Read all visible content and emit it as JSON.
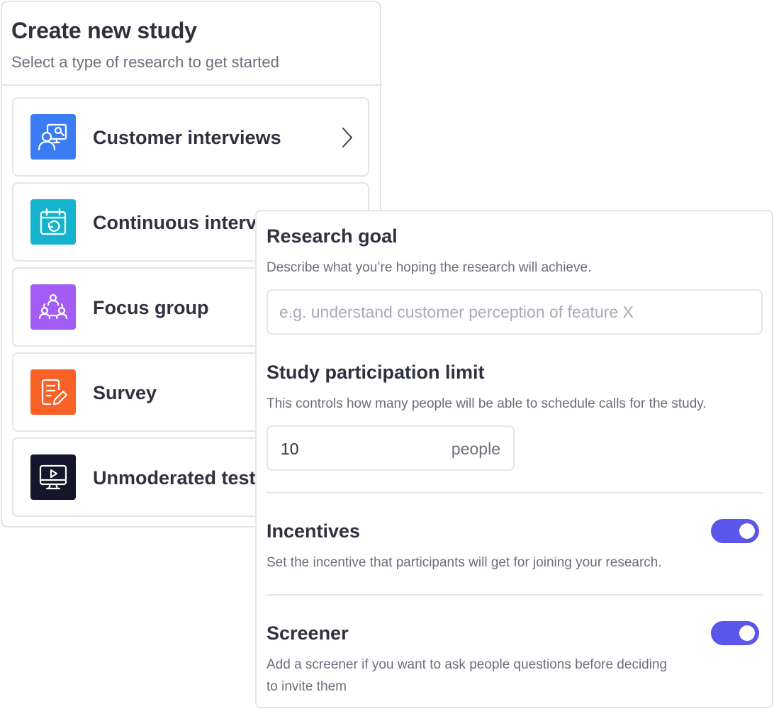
{
  "study_card": {
    "title": "Create new study",
    "subtitle": "Select a type of research to get started",
    "types": [
      {
        "label": "Customer interviews",
        "icon": "presentation-user-icon",
        "color": "#3b7cf5"
      },
      {
        "label": "Continuous interviews",
        "icon": "calendar-refresh-icon",
        "color": "#16b3cf"
      },
      {
        "label": "Focus group",
        "icon": "group-users-icon",
        "color": "#a35cf4"
      },
      {
        "label": "Survey",
        "icon": "document-edit-icon",
        "color": "#fa6127"
      },
      {
        "label": "Unmoderated testing",
        "icon": "monitor-play-icon",
        "color": "#15152b"
      }
    ]
  },
  "config_panel": {
    "research_goal": {
      "title": "Research goal",
      "description": "Describe what you’re hoping the research will achieve.",
      "placeholder": "e.g. understand customer perception of feature X",
      "value": ""
    },
    "participation_limit": {
      "title": "Study participation limit",
      "description": "This controls how many people will be able to schedule calls for the study.",
      "value": "10",
      "unit": "people"
    },
    "incentives": {
      "title": "Incentives",
      "description": "Set the incentive that participants will get for joining your research.",
      "enabled": true
    },
    "screener": {
      "title": "Screener",
      "description_line1": "Add a screener if you want to ask people questions before deciding",
      "description_line2": "to invite them",
      "enabled": true
    },
    "accent_color": "#5b56ec"
  }
}
